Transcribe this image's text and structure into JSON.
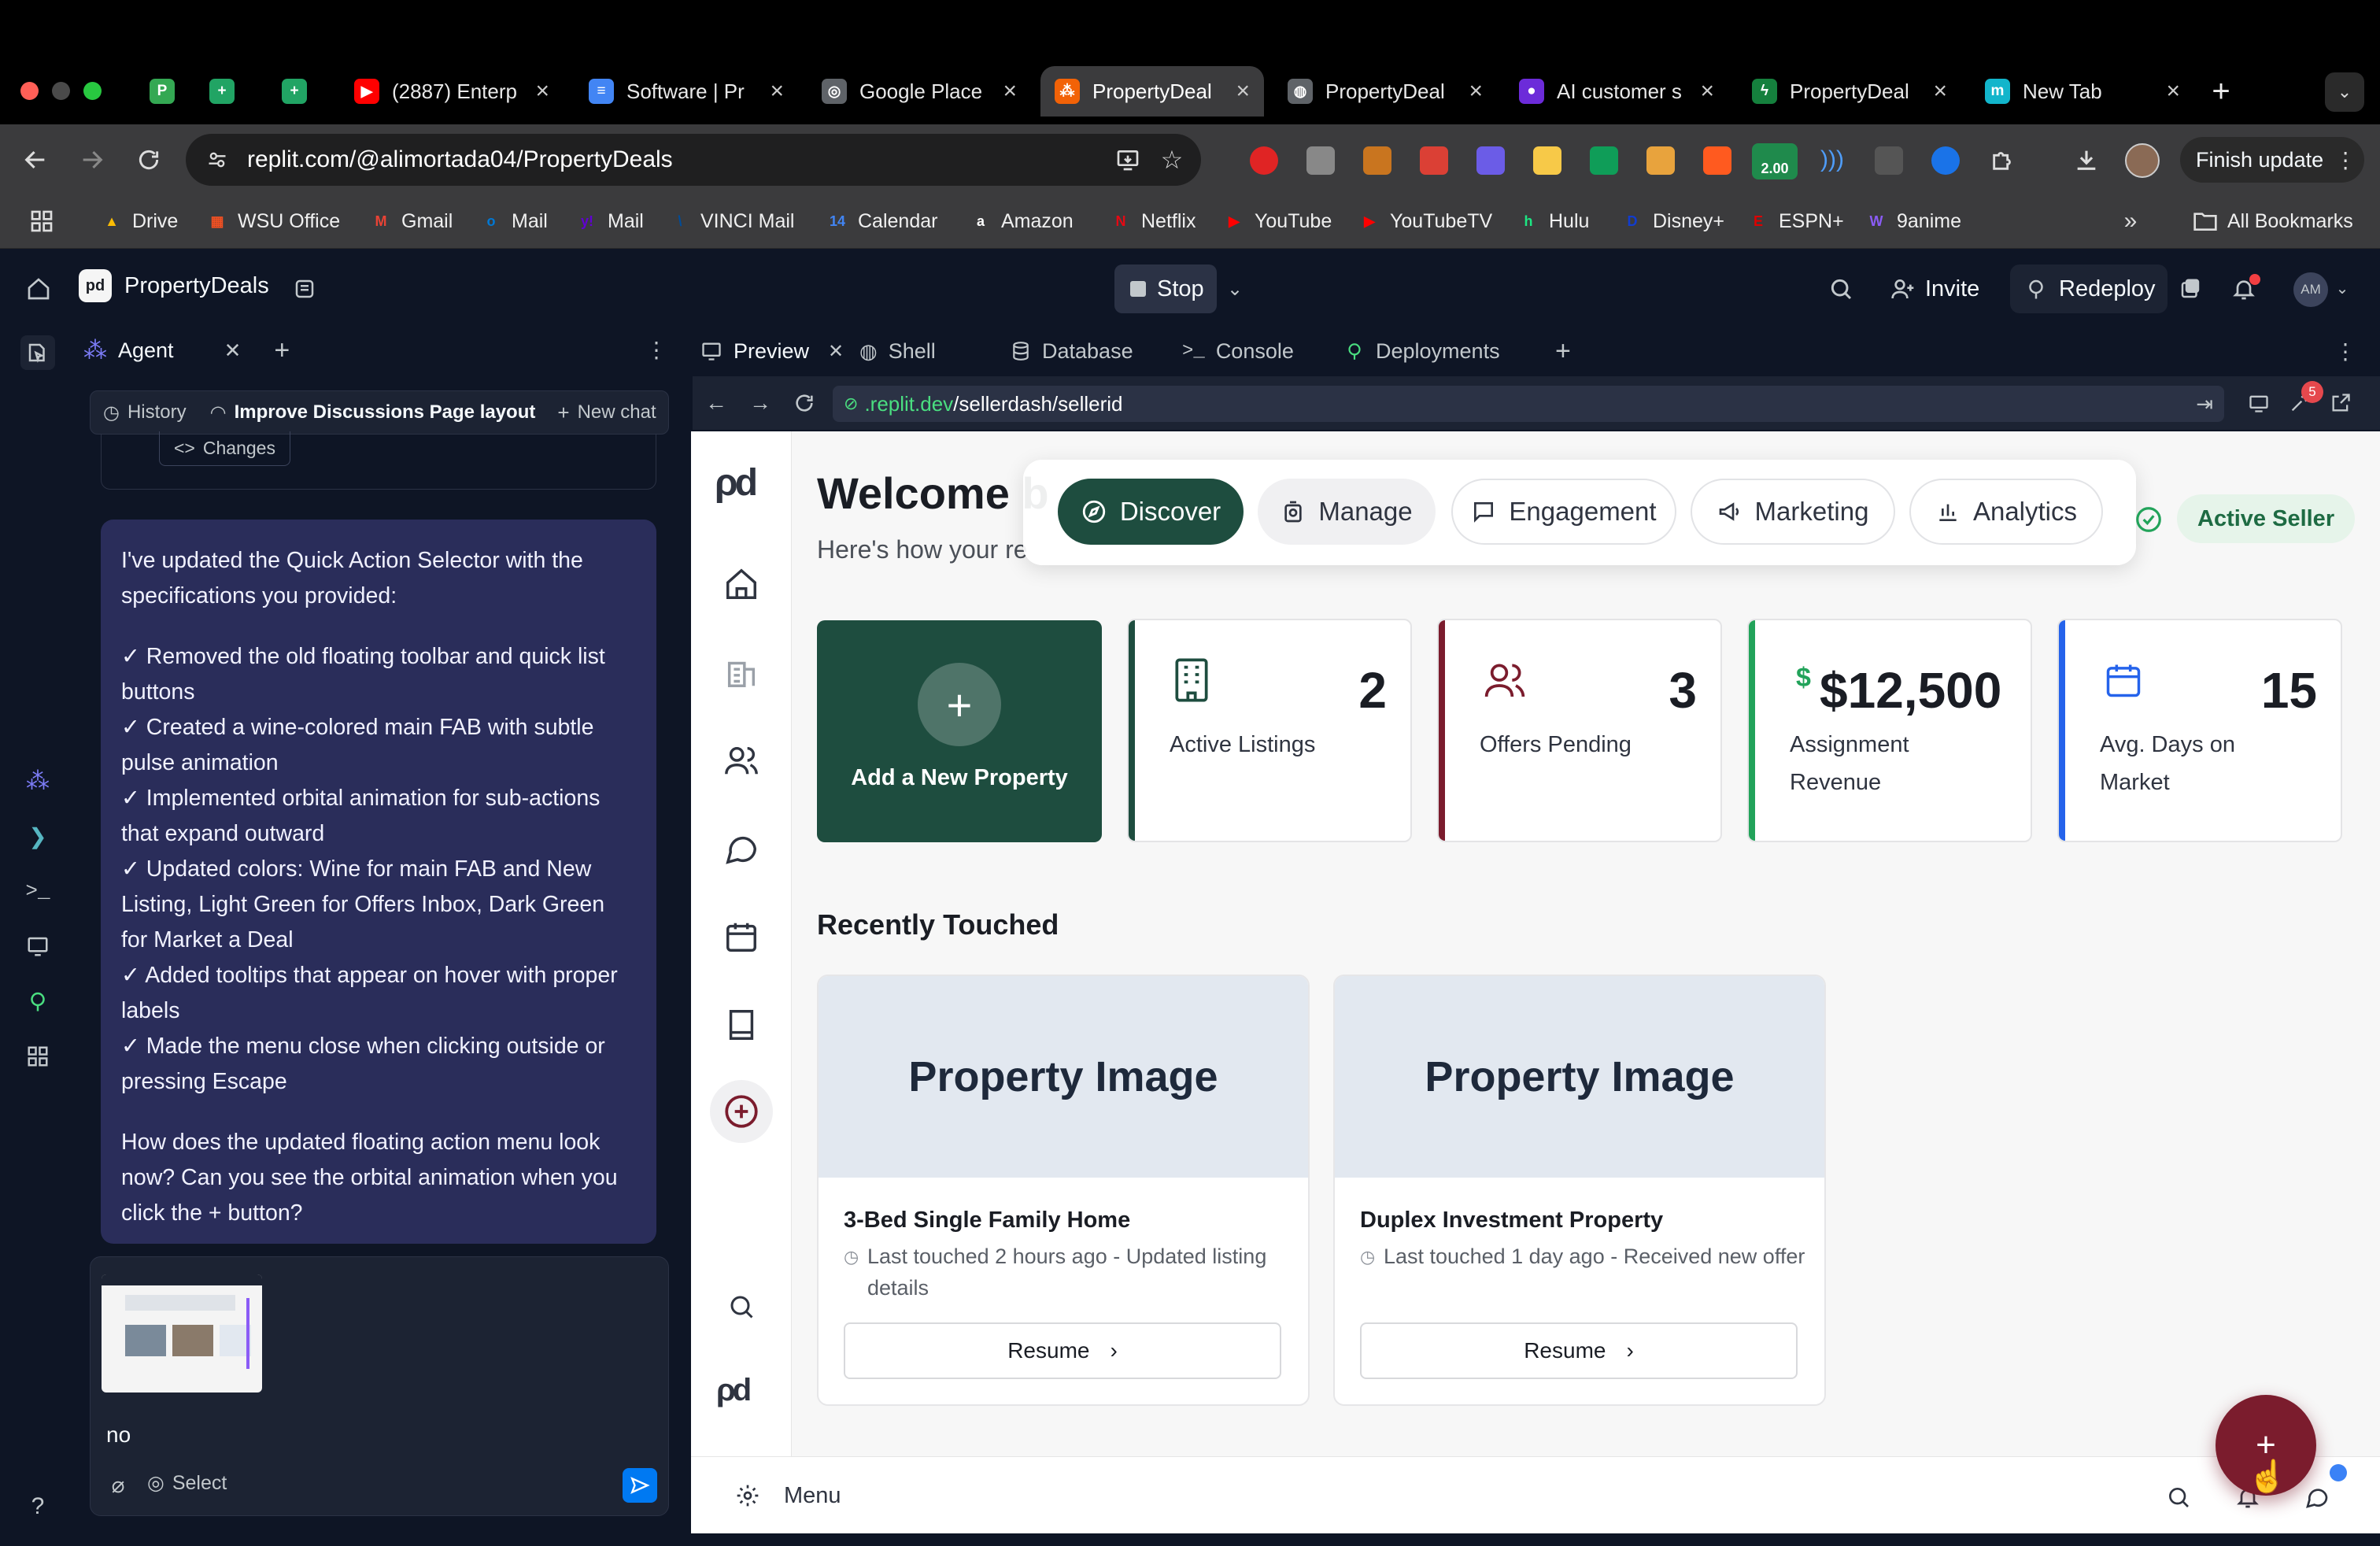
{
  "browser": {
    "tabs": [
      {
        "title": "",
        "fav": "P",
        "fav_color": "#34a853"
      },
      {
        "title": "",
        "fav": "+",
        "fav_color": "#21a464"
      },
      {
        "title": "",
        "fav": "+",
        "fav_color": "#21a464"
      },
      {
        "title": "(2887) Enterp",
        "fav": "▶",
        "fav_color": "#ff0000"
      },
      {
        "title": "Software | Pr",
        "fav": "≡",
        "fav_color": "#4285f4"
      },
      {
        "title": "Google Place",
        "fav": "◎",
        "fav_color": "#5f6368"
      },
      {
        "title": "PropertyDeal",
        "fav": "⁂",
        "fav_color": "#f26207"
      },
      {
        "title": "PropertyDeal",
        "fav": "◍",
        "fav_color": "#5f6368"
      },
      {
        "title": "AI customer s",
        "fav": "●",
        "fav_color": "#6c2bd9"
      },
      {
        "title": "PropertyDeal",
        "fav": "ϟ",
        "fav_color": "#15803d"
      },
      {
        "title": "New Tab",
        "fav": "m",
        "fav_color": "#12b5cb"
      }
    ],
    "url": "replit.com/@alimortada04/PropertyDeals",
    "finish_update": "Finish update",
    "extension_badge": "2.00",
    "bookmarks": [
      {
        "label": "Drive",
        "icon": "drive-icon",
        "color": "#fbbc04",
        "glyph": "▲"
      },
      {
        "label": "WSU Office",
        "icon": "office-icon",
        "color": "#f25022",
        "glyph": "▦"
      },
      {
        "label": "Gmail",
        "icon": "gmail-icon",
        "color": "#ea4335",
        "glyph": "M"
      },
      {
        "label": "Mail",
        "icon": "outlook-icon",
        "color": "#0078d4",
        "glyph": "o"
      },
      {
        "label": "Mail",
        "icon": "yahoo-icon",
        "color": "#6001d2",
        "glyph": "y!"
      },
      {
        "label": "VINCI Mail",
        "icon": "vinci-icon",
        "color": "#004c99",
        "glyph": "\\"
      },
      {
        "label": "Calendar",
        "icon": "calendar-icon",
        "color": "#4285f4",
        "glyph": "14"
      },
      {
        "label": "Amazon",
        "icon": "amazon-icon",
        "color": "#ffffff",
        "glyph": "a"
      },
      {
        "label": "Netflix",
        "icon": "netflix-icon",
        "color": "#e50914",
        "glyph": "N"
      },
      {
        "label": "YouTube",
        "icon": "youtube-icon",
        "color": "#ff0000",
        "glyph": "▶"
      },
      {
        "label": "YouTubeTV",
        "icon": "youtubetv-icon",
        "color": "#ff0000",
        "glyph": "▶"
      },
      {
        "label": "Hulu",
        "icon": "hulu-icon",
        "color": "#1ce783",
        "glyph": "h"
      },
      {
        "label": "Disney+",
        "icon": "disney-icon",
        "color": "#113ccf",
        "glyph": "D"
      },
      {
        "label": "ESPN+",
        "icon": "espn-icon",
        "color": "#d00",
        "glyph": "E"
      },
      {
        "label": "9anime",
        "icon": "anime-icon",
        "color": "#8b5cf6",
        "glyph": "W"
      }
    ],
    "all_bookmarks": "All Bookmarks"
  },
  "replit": {
    "project": "PropertyDeals",
    "stop": "Stop",
    "invite": "Invite",
    "redeploy": "Redeploy",
    "avatar": "AM",
    "agent_tab": "Agent",
    "history": "History",
    "chat_title": "Improve Discussions Page layout",
    "new_chat": "New chat",
    "changes": "Changes",
    "message": {
      "intro": "I've updated the Quick Action Selector with the specifications you provided:",
      "items": [
        "✓ Removed the old floating toolbar and quick list buttons",
        "✓ Created a wine-colored main FAB with subtle pulse animation",
        "✓ Implemented orbital animation for sub-actions that expand outward",
        "✓ Updated colors: Wine for main FAB and New Listing, Light Green for Offers Inbox, Dark Green for Market a Deal",
        "✓ Added tooltips that appear on hover with proper labels",
        "✓ Made the menu close when clicking outside or pressing Escape"
      ],
      "question": "How does the updated floating action menu look now? Can you see the orbital animation when you click the + button?"
    },
    "composer_text": "no",
    "select": "Select",
    "ide_tabs": [
      "Preview",
      "Shell",
      "Database",
      "Console",
      "Deployments"
    ],
    "webview_url_domain": ".replit.dev",
    "webview_url_path": "/sellerdash/sellerid",
    "badge_count": "5"
  },
  "app": {
    "welcome": "Welcome b",
    "subtitle": "Here's how your re",
    "quick_nav": [
      "Discover",
      "Manage",
      "Engagement",
      "Marketing",
      "Analytics"
    ],
    "seller_status": "Active Seller",
    "add_property": "Add a New Property",
    "stats": [
      {
        "value": "2",
        "label": "Active Listings",
        "accent": "#1e4d3f",
        "icon": "building-icon"
      },
      {
        "value": "3",
        "label": "Offers Pending",
        "accent": "#7b1c2d",
        "icon": "users-icon"
      },
      {
        "value": "$12,500",
        "label": "Assignment Revenue",
        "accent": "#22a35a",
        "icon": "dollar-icon"
      },
      {
        "value": "15",
        "label": "Avg. Days on Market",
        "accent": "#2563eb",
        "icon": "calendar-icon"
      }
    ],
    "recent_heading": "Recently Touched",
    "properties": [
      {
        "image_label": "Property Image",
        "name": "3-Bed Single Family Home",
        "meta": "Last touched 2 hours ago - Updated listing details",
        "action": "Resume"
      },
      {
        "image_label": "Property Image",
        "name": "Duplex Investment Property",
        "meta": "Last touched 1 day ago - Received new offer",
        "action": "Resume"
      }
    ],
    "footer_menu": "Menu",
    "fab_label": "+"
  },
  "colors": {
    "wine": "#7b1c2d",
    "dark_green": "#1e4d3f",
    "light_green": "#22a35a",
    "blue": "#2563eb",
    "replit_bg": "#0e1525"
  }
}
